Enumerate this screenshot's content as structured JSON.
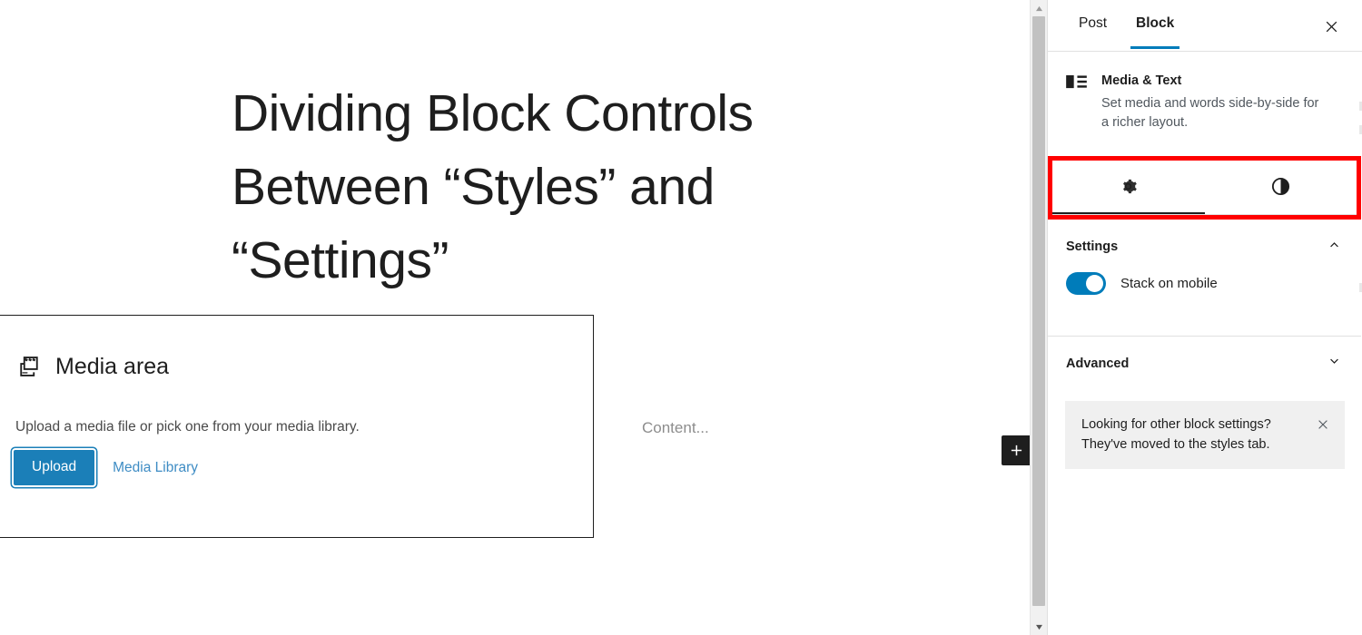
{
  "editor": {
    "post_title": "Dividing Block Controls Between “Styles” and “Settings”",
    "media_block": {
      "icon": "media-placeholder-icon",
      "label": "Media area",
      "instructions": "Upload a media file or pick one from your media library.",
      "upload_label": "Upload",
      "media_library_label": "Media Library"
    },
    "content_placeholder": "Content...",
    "add_block_icon": "plus-icon",
    "scrollbar": {
      "up_icon": "triangle-up-icon",
      "down_icon": "triangle-down-icon"
    }
  },
  "sidebar": {
    "top_tabs": [
      {
        "label": "Post",
        "active": false
      },
      {
        "label": "Block",
        "active": true
      }
    ],
    "close_icon": "close-icon",
    "block_card": {
      "icon": "media-and-text-icon",
      "title": "Media & Text",
      "description": "Set media and words side-by-side for a richer layout."
    },
    "icon_tabs": [
      {
        "icon": "gear-icon",
        "name": "settings-tab",
        "active": true
      },
      {
        "icon": "contrast-half-circle-icon",
        "name": "styles-tab",
        "active": false
      }
    ],
    "settings_panel": {
      "title": "Settings",
      "chevron": "chevron-up-icon",
      "stack_on_mobile": {
        "label": "Stack on mobile",
        "value": "on"
      }
    },
    "advanced_panel": {
      "title": "Advanced",
      "chevron": "chevron-down-icon"
    },
    "notice": {
      "text": "Looking for other block settings? They've moved to the styles tab.",
      "dismiss_icon": "close-icon"
    }
  },
  "colors": {
    "accent_blue": "#007cba",
    "upload_blue": "#1b7fb8",
    "highlight_red": "#ff0000",
    "dark": "#1e1e1e",
    "notice_bg": "#f0f0f0"
  }
}
